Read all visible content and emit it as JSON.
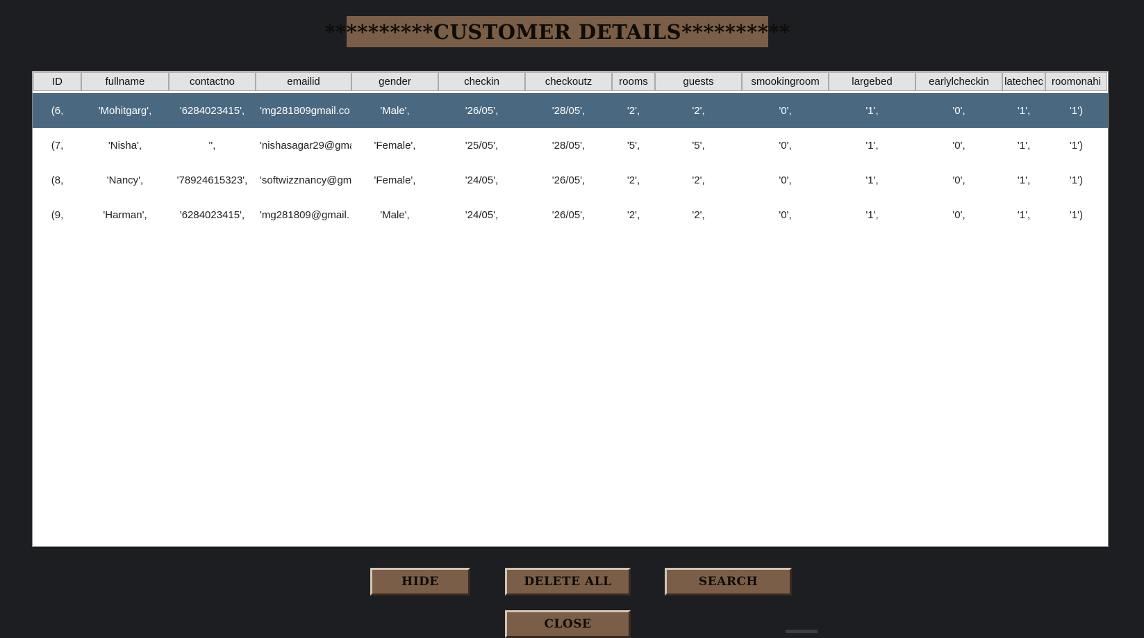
{
  "title": "**********CUSTOMER DETAILS**********",
  "table": {
    "columns": [
      "ID",
      "fullname",
      "contactno",
      "emailid",
      "gender",
      "checkin",
      "checkoutz",
      "rooms",
      "guests",
      "smookingroom",
      "largebed",
      "earlylcheckin",
      "latechec",
      "roomonahi"
    ],
    "rows": [
      [
        "(6,",
        "'Mohitgarg',",
        "'6284023415',",
        "'mg281809gmail.co",
        "'Male',",
        "'26/05',",
        "'28/05',",
        "'2',",
        "'2',",
        "'0',",
        "'1',",
        "'0',",
        "'1',",
        "'1')"
      ],
      [
        "(7,",
        "'Nisha',",
        "'',",
        "'nishasagar29@gma",
        "'Female',",
        "'25/05',",
        "'28/05',",
        "'5',",
        "'5',",
        "'0',",
        "'1',",
        "'0',",
        "'1',",
        "'1')"
      ],
      [
        "(8,",
        "'Nancy',",
        "'78924615323',",
        "'softwizznancy@gm",
        "'Female',",
        "'24/05',",
        "'26/05',",
        "'2',",
        "'2',",
        "'0',",
        "'1',",
        "'0',",
        "'1',",
        "'1')"
      ],
      [
        "(9,",
        "'Harman',",
        "'6284023415',",
        "'mg281809@gmail.",
        "'Male',",
        "'24/05',",
        "'26/05',",
        "'2',",
        "'2',",
        "'0',",
        "'1',",
        "'0',",
        "'1',",
        "'1')"
      ]
    ],
    "selected_row": 0
  },
  "buttons": {
    "hide": "HIDE",
    "delete_all": "DELETE ALL",
    "search": "SEARCH",
    "close": "CLOSE"
  },
  "colors": {
    "background": "#1c1e21",
    "accent_brown": "#7a5e47",
    "selection": "#4a6880"
  }
}
